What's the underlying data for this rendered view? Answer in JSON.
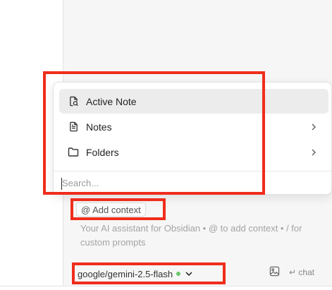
{
  "context_menu": {
    "items": [
      {
        "label": "Active Note",
        "icon": "active-note-icon",
        "has_submenu": false
      },
      {
        "label": "Notes",
        "icon": "note-file-icon",
        "has_submenu": true
      },
      {
        "label": "Folders",
        "icon": "folder-icon",
        "has_submenu": true
      }
    ],
    "search_placeholder": "Search..."
  },
  "chat_input": {
    "add_context_label": "@ Add context",
    "placeholder": "Your AI assistant for Obsidian • @ to add context • / for custom prompts",
    "model": "google/gemini-2.5-flash",
    "model_status_color": "#6cc76c",
    "chat_label": "↵ chat"
  },
  "colors": {
    "highlight": "#f02d1c",
    "panel_bg": "#f6f6f6"
  }
}
